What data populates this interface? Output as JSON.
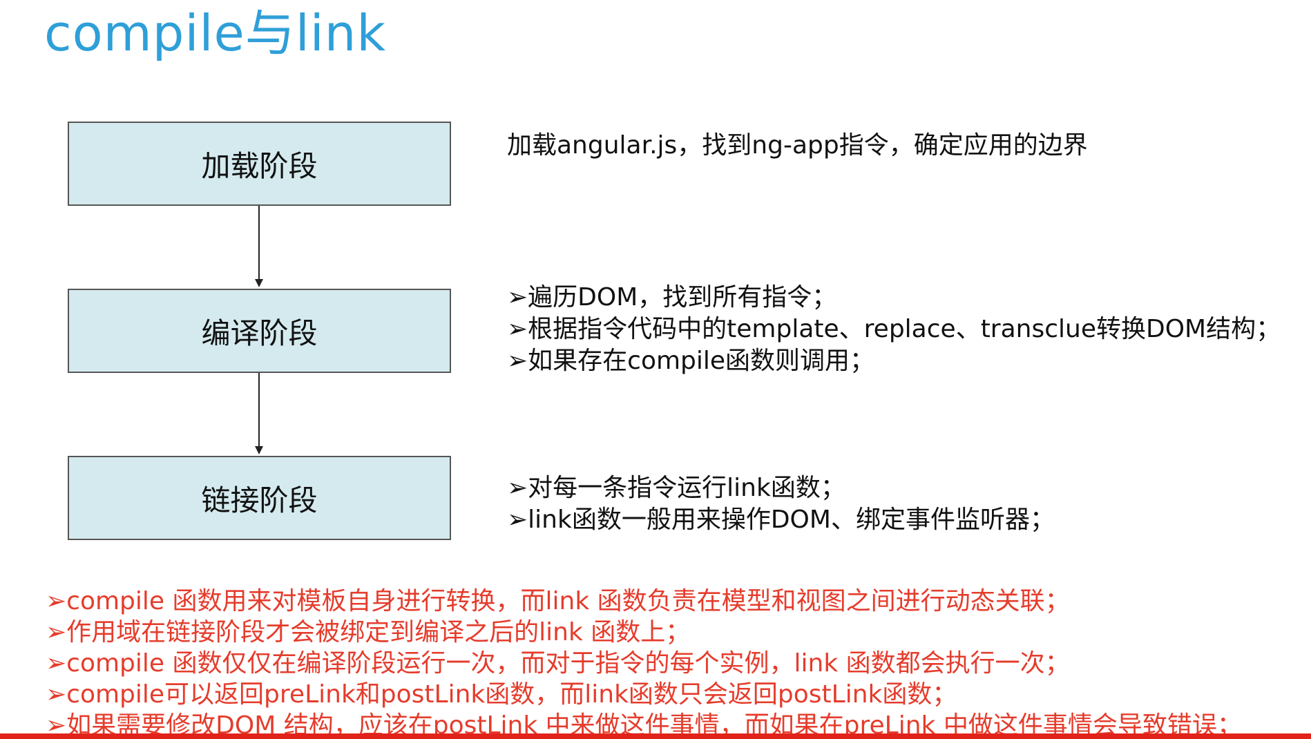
{
  "slide": {
    "title": "compile与link"
  },
  "stages": [
    {
      "label": "加载阶段"
    },
    {
      "label": "编译阶段"
    },
    {
      "label": "链接阶段"
    }
  ],
  "descriptions": {
    "load": [
      "加载angular.js，找到ng-app指令，确定应用的边界"
    ],
    "compile": [
      "➢遍历DOM，找到所有指令；",
      "➢根据指令代码中的template、replace、transclue转换DOM结构；",
      "➢如果存在compile函数则调用；"
    ],
    "link": [
      "➢对每一条指令运行link函数；",
      "➢link函数一般用来操作DOM、绑定事件监听器；"
    ]
  },
  "notes": [
    "➢compile 函数用来对模板自身进行转换，而link 函数负责在模型和视图之间进行动态关联；",
    "➢作用域在链接阶段才会被绑定到编译之后的link 函数上；",
    "➢compile 函数仅仅在编译阶段运行一次，而对于指令的每个实例，link 函数都会执行一次；",
    "➢compile可以返回preLink和postLink函数，而link函数只会返回postLink函数；",
    "➢如果需要修改DOM 结构，应该在postLink 中来做这件事情，而如果在preLink 中做这件事情会导致错误；"
  ],
  "colors": {
    "title": "#2f9fd8",
    "box_fill": "#d4eaee",
    "box_border": "#555555",
    "notes_text": "#e53c2c",
    "bottom_bar": "#e2231a"
  }
}
